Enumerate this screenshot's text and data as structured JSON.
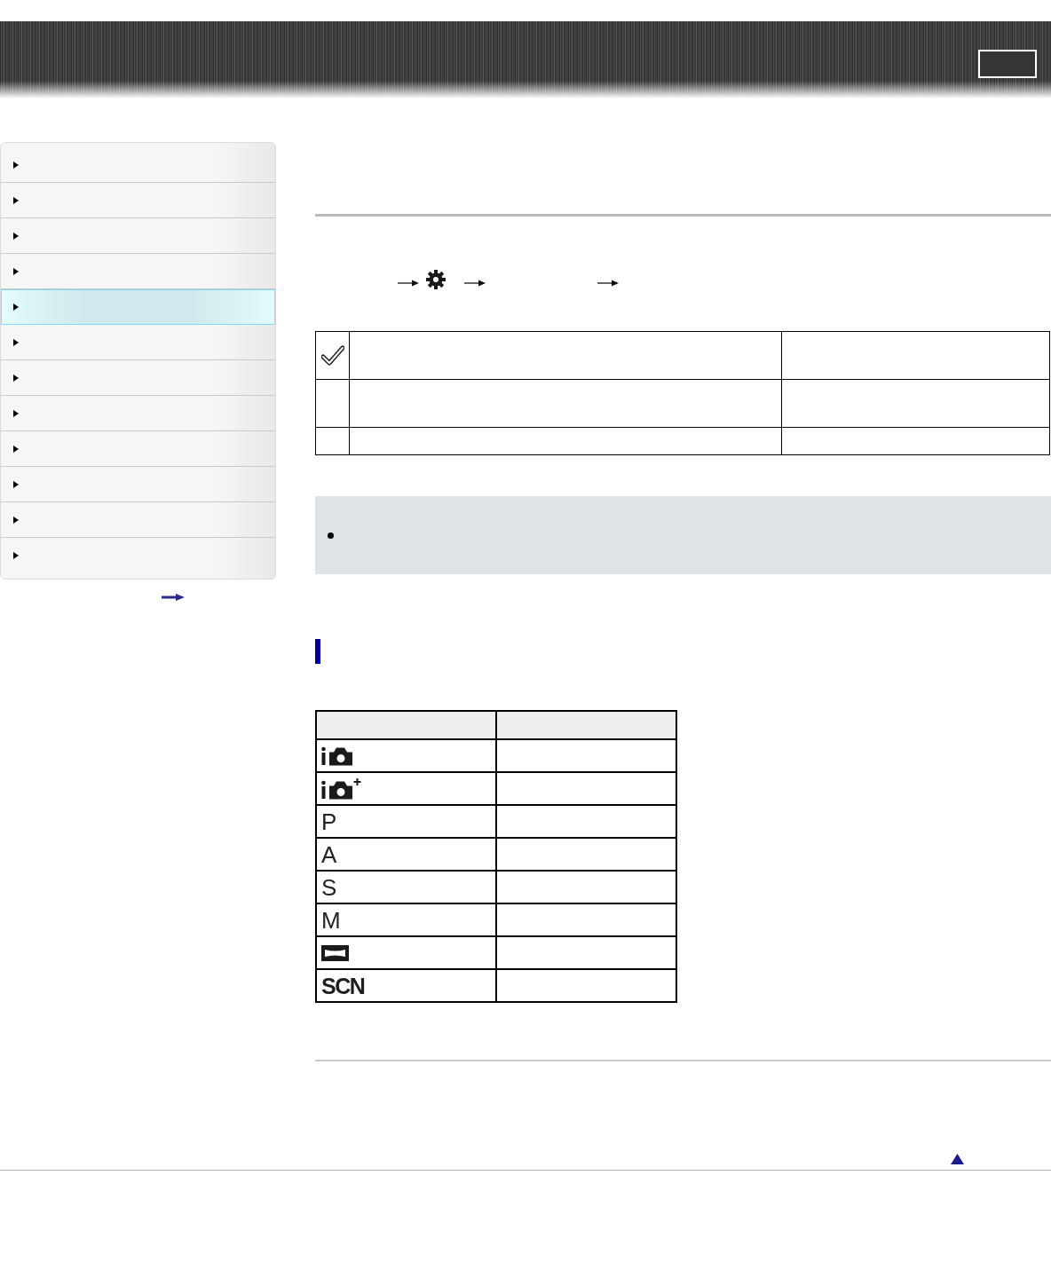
{
  "sidebar": {
    "items": [
      {
        "selected": false
      },
      {
        "selected": false
      },
      {
        "selected": false
      },
      {
        "selected": false
      },
      {
        "selected": true
      },
      {
        "selected": false
      },
      {
        "selected": false
      },
      {
        "selected": false
      },
      {
        "selected": false
      },
      {
        "selected": false
      },
      {
        "selected": false
      },
      {
        "selected": false
      }
    ]
  },
  "breadcrumb": [
    {
      "kind": "arrow"
    },
    {
      "kind": "gear"
    },
    {
      "kind": "arrow"
    },
    {
      "kind": "arrow"
    }
  ],
  "settings_table": {
    "rows": [
      {
        "default": true
      },
      {
        "default": false
      },
      {
        "default": false
      }
    ]
  },
  "note": {
    "items": [
      {
        "kind": "bullet"
      }
    ]
  },
  "mode_table": {
    "rows": [
      {
        "kind": "camera"
      },
      {
        "kind": "cameraplus"
      },
      {
        "kind": "text",
        "label": "P",
        "bold": false
      },
      {
        "kind": "text",
        "label": "A",
        "bold": false
      },
      {
        "kind": "text",
        "label": "S",
        "bold": false
      },
      {
        "kind": "text",
        "label": "M",
        "bold": false
      },
      {
        "kind": "panorama"
      },
      {
        "kind": "text",
        "label": "SCN",
        "bold": true
      }
    ]
  }
}
